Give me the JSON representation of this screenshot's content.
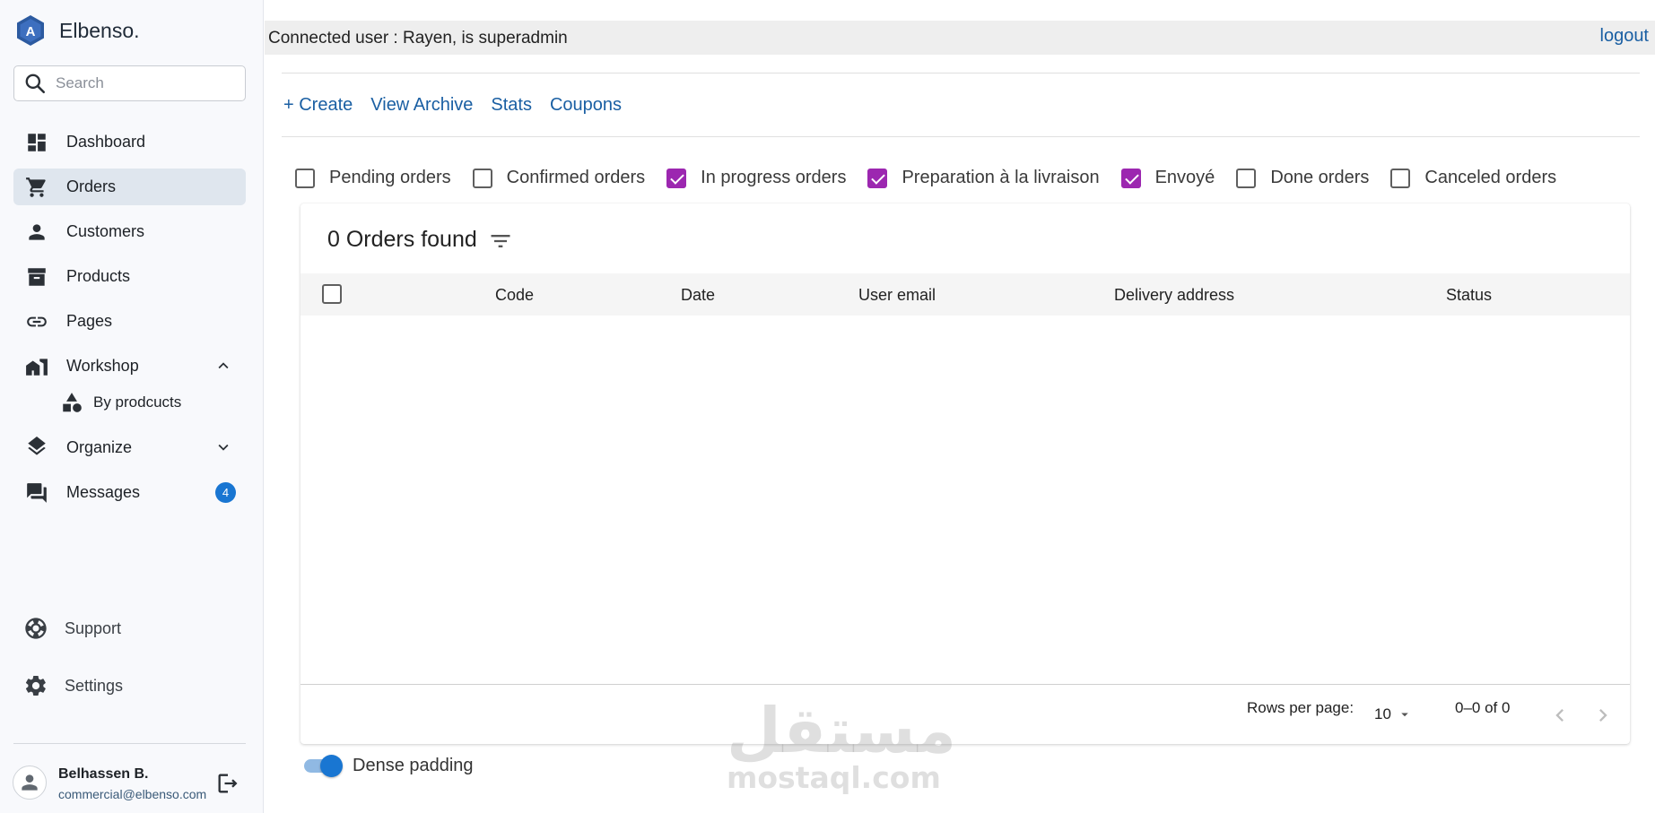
{
  "brand": {
    "name": "Elbenso.",
    "logo_letter": "A",
    "logo_color": "#2c5aa0"
  },
  "search": {
    "placeholder": "Search"
  },
  "sidebar": {
    "items": [
      {
        "label": "Dashboard",
        "icon": "dashboard-icon"
      },
      {
        "label": "Orders",
        "icon": "cart-icon",
        "active": true
      },
      {
        "label": "Customers",
        "icon": "person-icon"
      },
      {
        "label": "Products",
        "icon": "archive-icon"
      },
      {
        "label": "Pages",
        "icon": "link-icon"
      },
      {
        "label": "Workshop",
        "icon": "workshop-icon",
        "expanded": true
      },
      {
        "label": "Organize",
        "icon": "layers-icon",
        "expanded": false
      },
      {
        "label": "Messages",
        "icon": "forum-icon",
        "badge": "4"
      }
    ],
    "workshop_sub": {
      "label": "By prodcucts",
      "icon": "category-icon"
    },
    "bottom": [
      {
        "label": "Support",
        "icon": "support-icon"
      },
      {
        "label": "Settings",
        "icon": "gear-icon"
      }
    ]
  },
  "user": {
    "name": "Belhassen B.",
    "email": "commercial@elbenso.com"
  },
  "topbar": {
    "connected_user": "Connected user : Rayen, is superadmin",
    "logout": "logout"
  },
  "actions": {
    "create": "+ Create",
    "view_archive": "View Archive",
    "stats": "Stats",
    "coupons": "Coupons"
  },
  "filters": [
    {
      "label": "Pending orders",
      "checked": false
    },
    {
      "label": "Confirmed orders",
      "checked": false
    },
    {
      "label": "In progress orders",
      "checked": true
    },
    {
      "label": "Preparation à la livraison",
      "checked": true
    },
    {
      "label": "Envoyé",
      "checked": true
    },
    {
      "label": "Done orders",
      "checked": false
    },
    {
      "label": "Canceled orders",
      "checked": false
    }
  ],
  "table": {
    "title": "0 Orders found",
    "columns": [
      "Code",
      "Date",
      "User email",
      "Delivery address",
      "Status"
    ],
    "rows": []
  },
  "pagination": {
    "rows_per_page_label": "Rows per page:",
    "rows_per_page": "10",
    "range": "0–0 of 0"
  },
  "dense_padding": {
    "label": "Dense padding",
    "on": true
  },
  "watermark": {
    "arabic": "مستقل",
    "latin": "mostaql.com"
  },
  "colors": {
    "accent_check": "#9c27b0",
    "link": "#1a5fa3",
    "badge": "#1976d2",
    "active_nav": "#dfe6ee"
  }
}
